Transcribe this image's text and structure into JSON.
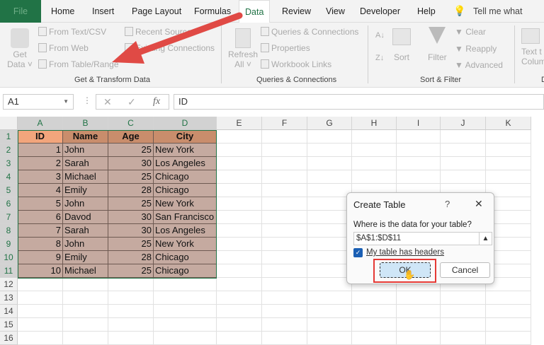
{
  "tabs": [
    "File",
    "Home",
    "Insert",
    "Page Layout",
    "Formulas",
    "Data",
    "Review",
    "View",
    "Developer",
    "Help"
  ],
  "tell_me": "Tell me what you w",
  "ribbon": {
    "get_data": [
      "Get",
      "Data ˅"
    ],
    "from_text": "From Text/CSV",
    "from_web": "From Web",
    "from_table": "From Table/Range",
    "recent_sources": "Recent Sources",
    "existing_connections": "Existing Connections",
    "group1": "Get & Transform Data",
    "refresh": [
      "Refresh",
      "All ˅"
    ],
    "queries": "Queries & Connections",
    "properties": "Properties",
    "workbook_links": "Workbook Links",
    "group2": "Queries & Connections",
    "sort": "Sort",
    "filter": "Filter",
    "clear": "Clear",
    "reapply": "Reapply",
    "advanced": "Advanced",
    "group3": "Sort & Filter",
    "text_to_columns": [
      "Text t",
      "Colum"
    ],
    "group4": "D"
  },
  "formula_bar": {
    "name_box": "A1",
    "fx": "fx",
    "content": "ID"
  },
  "columns": [
    "A",
    "B",
    "C",
    "D",
    "E",
    "F",
    "G",
    "H",
    "I",
    "J",
    "K"
  ],
  "table": {
    "headers": [
      "ID",
      "Name",
      "Age",
      "City"
    ],
    "rows": [
      [
        1,
        "John",
        25,
        "New York"
      ],
      [
        2,
        "Sarah",
        30,
        "Los Angeles"
      ],
      [
        3,
        "Michael",
        25,
        "Chicago"
      ],
      [
        4,
        "Emily",
        28,
        "Chicago"
      ],
      [
        5,
        "John",
        25,
        "New York"
      ],
      [
        6,
        "Davod",
        30,
        "San Francisco"
      ],
      [
        7,
        "Sarah",
        30,
        "Los Angeles"
      ],
      [
        8,
        "John",
        25,
        "New York"
      ],
      [
        9,
        "Emily",
        28,
        "Chicago"
      ],
      [
        10,
        "Michael",
        25,
        "Chicago"
      ]
    ]
  },
  "row_numbers": [
    1,
    2,
    3,
    4,
    5,
    6,
    7,
    8,
    9,
    10,
    11,
    12,
    13,
    14,
    15,
    16
  ],
  "dialog": {
    "title": "Create Table",
    "help": "?",
    "close": "✕",
    "prompt": "Where is the data for your table?",
    "range": "$A$1:$D$11",
    "checkbox_label": "My table has headers",
    "checked": true,
    "ok": "OK",
    "cancel": "Cancel"
  },
  "colors": {
    "accent": "#217346",
    "arrow": "#e04a45",
    "highlight": "#e53935"
  }
}
